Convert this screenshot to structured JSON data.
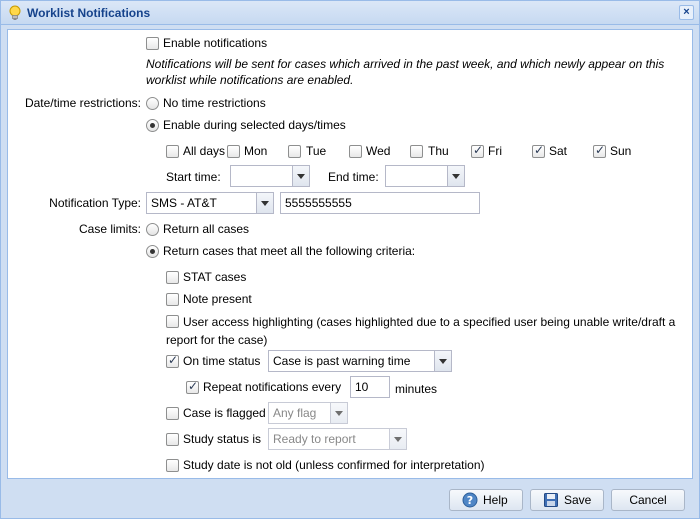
{
  "window": {
    "title": "Worklist Notifications",
    "close_symbol": "×"
  },
  "enable": {
    "label": "Enable notifications",
    "checked": false,
    "note": "Notifications will be sent for cases which arrived in the past week, and which newly appear on this worklist while notifications are enabled."
  },
  "datetime": {
    "label": "Date/time restrictions:",
    "options": [
      {
        "label": "No time restrictions",
        "checked": false
      },
      {
        "label": "Enable during selected days/times",
        "checked": true
      }
    ],
    "days": [
      {
        "label": "All days",
        "checked": false
      },
      {
        "label": "Mon",
        "checked": false
      },
      {
        "label": "Tue",
        "checked": false
      },
      {
        "label": "Wed",
        "checked": false
      },
      {
        "label": "Thu",
        "checked": false
      },
      {
        "label": "Fri",
        "checked": true
      },
      {
        "label": "Sat",
        "checked": true
      },
      {
        "label": "Sun",
        "checked": true
      }
    ],
    "start_label": "Start time:",
    "start_value": "",
    "end_label": "End time:",
    "end_value": ""
  },
  "notification_type": {
    "label": "Notification Type:",
    "value": "SMS - AT&T",
    "phone": "5555555555"
  },
  "case_limits": {
    "label": "Case limits:",
    "options": [
      {
        "label": "Return all cases",
        "checked": false
      },
      {
        "label": "Return cases that meet all the following criteria:",
        "checked": true
      }
    ],
    "stat": {
      "label": "STAT cases",
      "checked": false
    },
    "note_present": {
      "label": "Note present",
      "checked": false
    },
    "user_access": {
      "label": "User access highlighting (cases highlighted due to a specified user being unable write/draft a report for the case)",
      "checked": false
    },
    "on_time": {
      "label": "On time status",
      "checked": true,
      "value": "Case is past warning time"
    },
    "repeat": {
      "label": "Repeat notifications every",
      "checked": true,
      "value": "10",
      "unit": "minutes"
    },
    "flagged": {
      "label": "Case is flagged",
      "checked": false,
      "value": "Any flag"
    },
    "study_status": {
      "label": "Study status is",
      "checked": false,
      "value": "Ready to report"
    },
    "study_date": {
      "label": "Study date is not old (unless confirmed for interpretation)",
      "checked": false
    }
  },
  "buttons": {
    "help": "Help",
    "save": "Save",
    "cancel": "Cancel"
  },
  "colors": {
    "title": "#15428b",
    "frame": "#cfdef2",
    "border": "#99bbe8"
  }
}
